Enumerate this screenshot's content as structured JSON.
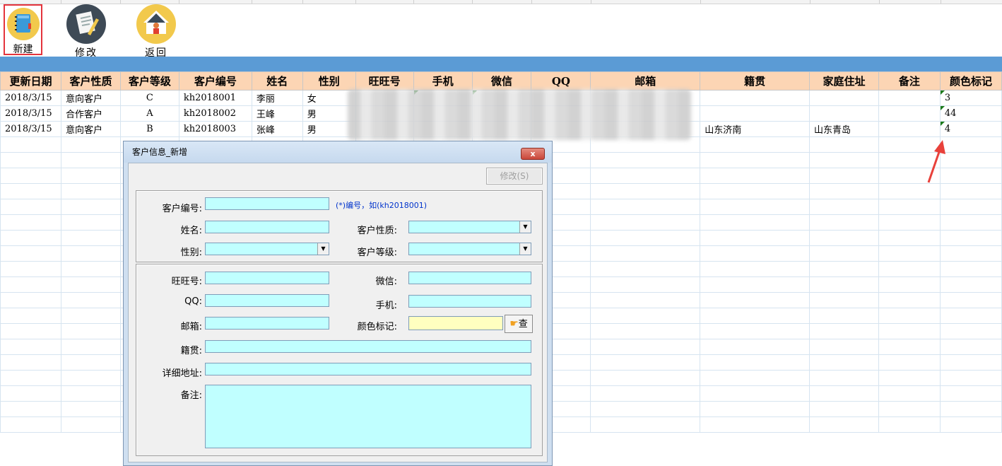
{
  "toolbar": {
    "new_label": "新建",
    "edit_label": "修改",
    "back_label": "返回"
  },
  "columns": [
    "更新日期",
    "客户性质",
    "客户等级",
    "客户编号",
    "姓名",
    "性别",
    "旺旺号",
    "手机",
    "微信",
    "QQ",
    "邮箱",
    "籍贯",
    "家庭住址",
    "备注",
    "颜色标记"
  ],
  "rows": [
    {
      "date": "2018/3/15",
      "nature": "意向客户",
      "level": "C",
      "id": "kh2018001",
      "name": "李丽",
      "gender": "女",
      "native": "",
      "address": "",
      "remark": "",
      "color": "3"
    },
    {
      "date": "2018/3/15",
      "nature": "合作客户",
      "level": "A",
      "id": "kh2018002",
      "name": "王峰",
      "gender": "男",
      "native": "",
      "address": "",
      "remark": "",
      "color": "44"
    },
    {
      "date": "2018/3/15",
      "nature": "意向客户",
      "level": "B",
      "id": "kh2018003",
      "name": "张峰",
      "gender": "男",
      "native": "山东济南",
      "address": "山东青岛",
      "remark": "",
      "color": "4"
    }
  ],
  "dialog": {
    "title": "客户信息_新增",
    "close": "x",
    "edit_button": "修改(S)",
    "labels": {
      "cust_id": "客户编号:",
      "name": "姓名:",
      "gender": "性别:",
      "nature": "客户性质:",
      "level": "客户等级:",
      "wangwang": "旺旺号:",
      "wechat": "微信:",
      "qq": "QQ:",
      "phone": "手机:",
      "email": "邮箱:",
      "color": "颜色标记:",
      "native": "籍贯:",
      "address": "详细地址:",
      "remark": "备注:"
    },
    "hint": "(*)编号，如(kh2018001)",
    "lookup_button": "查"
  },
  "colors": {
    "header_bg": "#fcd5b4",
    "band": "#5b9bd5",
    "field_bg": "#c0ffff",
    "color_field_bg": "#ffffc0",
    "arrow": "#e8413b"
  }
}
